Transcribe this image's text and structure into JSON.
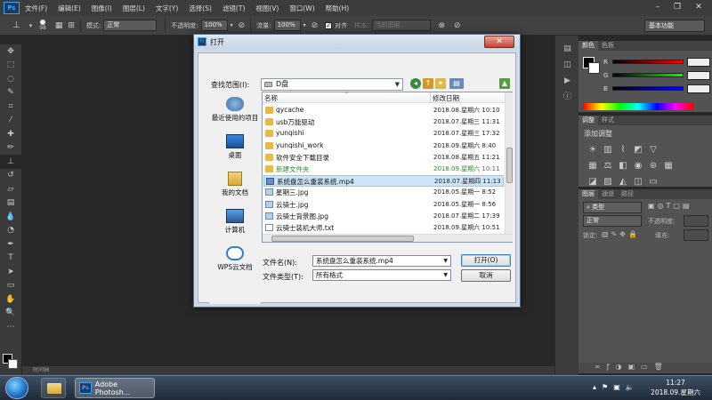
{
  "app": {
    "logo": "Ps",
    "menu": [
      "文件(F)",
      "编辑(E)",
      "图像(I)",
      "图层(L)",
      "文字(Y)",
      "选择(S)",
      "滤镜(T)",
      "视图(V)",
      "窗口(W)",
      "帮助(H)"
    ]
  },
  "options": {
    "brush_size": "98",
    "mode_label": "模式:",
    "mode_value": "正常",
    "opacity_label": "不透明度:",
    "opacity_value": "100%",
    "flow_label": "流量:",
    "flow_value": "100%",
    "align_label": "对齐",
    "sample_label": "样本:",
    "sample_value": "当前图层",
    "workspace": "基本功能"
  },
  "panels": {
    "color_tabs": [
      "颜色",
      "色板"
    ],
    "color_rows": [
      "R",
      "G",
      "B"
    ],
    "adjust_tabs": [
      "调整",
      "样式"
    ],
    "adjust_title": "添加调整",
    "layers_tabs": [
      "图层",
      "通道",
      "路径"
    ],
    "layers_kind": "类型",
    "layers_blend": "正常",
    "layers_opacity_label": "不透明度:",
    "layers_lock_label": "锁定:",
    "layers_fill_label": "填充:"
  },
  "statusbar": {
    "label": "时间轴"
  },
  "taskbar": {
    "app_label": "Adobe Photosh...",
    "time": "11:27",
    "date": "2018.09.星期六"
  },
  "dialog": {
    "title": "打开",
    "look_in_label": "查找范围(I):",
    "look_in_value": "D盘",
    "columns": {
      "name": "名称",
      "date": "修改日期"
    },
    "places": [
      "最近使用的项目",
      "桌面",
      "我的文档",
      "计算机",
      "WPS云文档"
    ],
    "files": [
      {
        "name": "qycache",
        "date": "2018.08.星期六 10:10",
        "type": "folder"
      },
      {
        "name": "usb万能驱动",
        "date": "2018.07.星期三 11:31",
        "type": "folder"
      },
      {
        "name": "yunqishi",
        "date": "2018.07.星期三 17:32",
        "type": "folder"
      },
      {
        "name": "yunqishi_work",
        "date": "2018.09.星期六 8:40",
        "type": "folder"
      },
      {
        "name": "软件安全下载目录",
        "date": "2018.08.星期五 11:21",
        "type": "folder"
      },
      {
        "name": "新建文件夹",
        "date": "2018.09.星期六 10:11",
        "type": "folder-new"
      },
      {
        "name": "系统盘怎么重装系统.mp4",
        "date": "2018.07.星期四 11:13",
        "type": "mp4"
      },
      {
        "name": "星期三.jpg",
        "date": "2018.05.星期一 8:52",
        "type": "jpg"
      },
      {
        "name": "云骑士.jpg",
        "date": "2018.05.星期一 8:56",
        "type": "jpg"
      },
      {
        "name": "云骑士背景图.jpg",
        "date": "2018.07.星期二 17:39",
        "type": "jpg"
      },
      {
        "name": "云骑士装机大师.txt",
        "date": "2018.09.星期六 10:51",
        "type": "txt"
      }
    ],
    "filename_label": "文件名(N):",
    "filename_value": "系统盘怎么重装系统.mp4",
    "filetype_label": "文件类型(T):",
    "filetype_value": "所有格式",
    "open_button": "打开(O)",
    "cancel_button": "取消"
  }
}
